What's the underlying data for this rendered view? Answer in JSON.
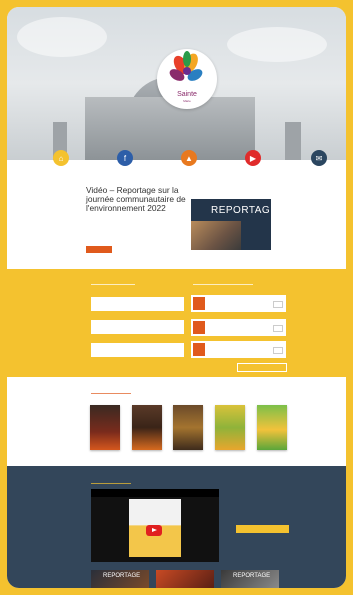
{
  "hero": {
    "logo_name": "Sainte",
    "logo_sub": "Marie"
  },
  "nav": [
    {
      "label": "",
      "color": "#f4c22f",
      "icon": "home-icon",
      "glyph": "⌂"
    },
    {
      "label": "",
      "color": "#2d5ea8",
      "icon": "facebook-icon",
      "glyph": "f"
    },
    {
      "label": "",
      "color": "#e8791f",
      "icon": "town-hall-icon",
      "glyph": "▲"
    },
    {
      "label": "",
      "color": "#e02b2b",
      "icon": "youtube-icon",
      "glyph": "▶"
    },
    {
      "label": "",
      "color": "#2b4660",
      "icon": "newsletter-icon",
      "glyph": "✉"
    }
  ],
  "video": {
    "title": "Vidéo – Reportage sur la journée communautaire de l'environnement 2022",
    "description": "",
    "button": "",
    "reportage_title": "REPORTAGE",
    "reportage_sub": ""
  },
  "news": {
    "heading": "",
    "items": [
      {
        "title": "",
        "date": ""
      },
      {
        "title": "",
        "date": ""
      },
      {
        "title": "",
        "date": ""
      }
    ],
    "link": ""
  },
  "agenda": {
    "heading": "",
    "items": [
      {
        "day": "",
        "title": "",
        "date": "",
        "more": ""
      },
      {
        "day": "",
        "title": "",
        "date": "",
        "more": ""
      },
      {
        "day": "",
        "title": "",
        "date": "",
        "more": ""
      }
    ],
    "button": ""
  },
  "magazines": {
    "heading": "",
    "titles": [
      "",
      "",
      "",
      "",
      ""
    ],
    "link": ""
  },
  "videos": {
    "heading": "",
    "player_title": "",
    "youtube_label": "",
    "button": "",
    "thumbs": [
      "REPORTAGE",
      "",
      "REPORTAGE"
    ]
  },
  "colors": {
    "accent": "#f4c22f",
    "orange": "#e05a1c",
    "navy": "#33465a"
  }
}
